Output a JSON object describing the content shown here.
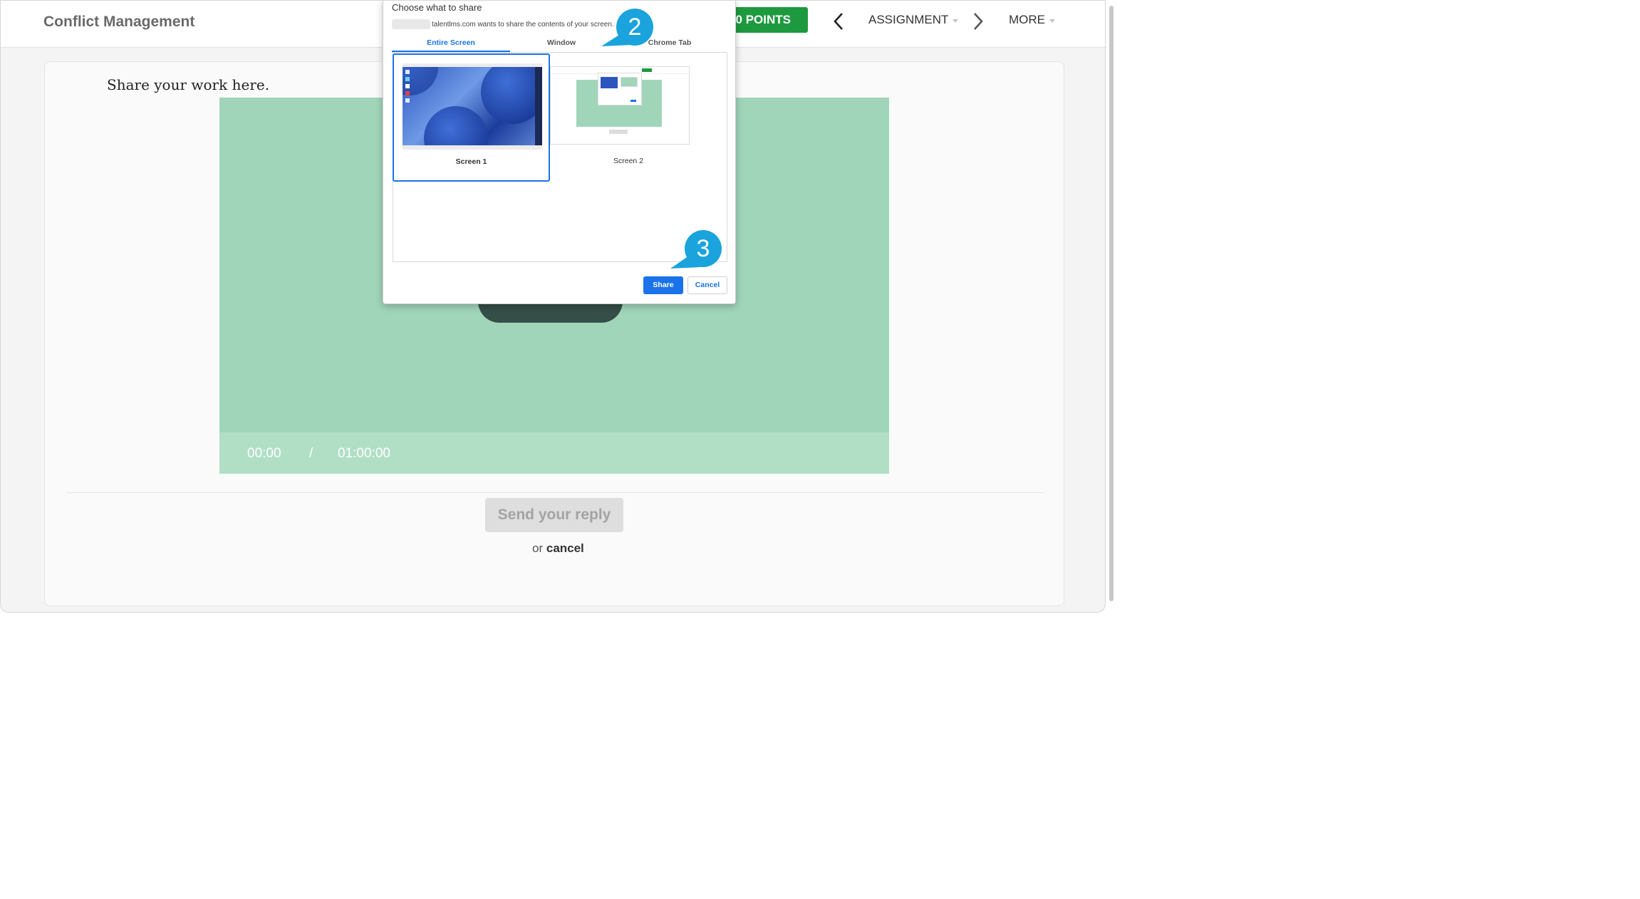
{
  "header": {
    "course_title": "Conflict Management",
    "points_label": "90 POINTS",
    "assignment_label": "ASSIGNMENT",
    "more_label": "MORE"
  },
  "main": {
    "share_heading": "Share your work here.",
    "time_current": "00:00",
    "time_separator": "/",
    "time_total": "01:00:00",
    "send_button": "Send your reply",
    "or_text": "or",
    "cancel_link": "cancel"
  },
  "dialog": {
    "title": "Choose what to share",
    "subtitle": "talentlms.com wants to share the contents of your screen.",
    "tabs": [
      {
        "label": "Entire Screen",
        "active": true
      },
      {
        "label": "Window",
        "active": false
      },
      {
        "label": "Chrome Tab",
        "active": false
      }
    ],
    "sources": [
      {
        "label": "Screen 1",
        "selected": true
      },
      {
        "label": "Screen 2",
        "selected": false
      }
    ],
    "share_button": "Share",
    "cancel_button": "Cancel"
  },
  "callouts": [
    {
      "number": "2"
    },
    {
      "number": "3"
    }
  ],
  "colors": {
    "points_green": "#1d9a3f",
    "video_green": "#a0d5ba",
    "accent_blue": "#1a73e8",
    "callout_blue": "#1aa3dc"
  }
}
